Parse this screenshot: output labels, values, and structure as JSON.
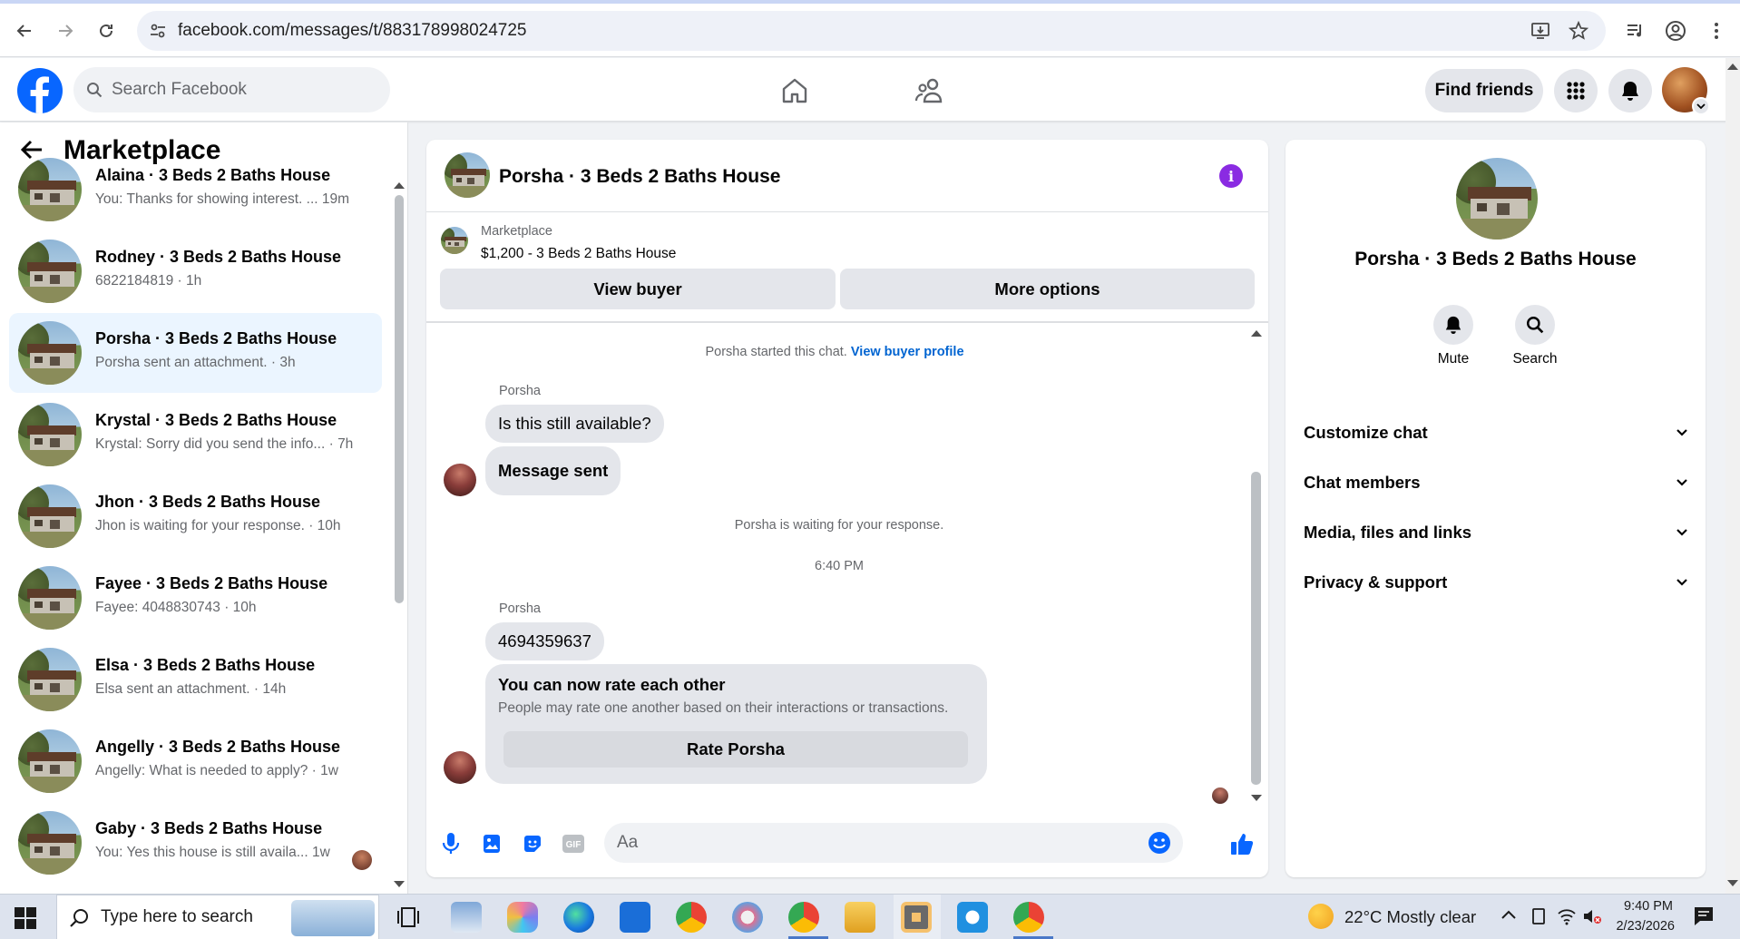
{
  "browser": {
    "url": "facebook.com/messages/t/883178998024725"
  },
  "header": {
    "search_placeholder": "Search Facebook",
    "find_friends": "Find friends"
  },
  "sidebar": {
    "title": "Marketplace",
    "conversations": [
      {
        "name": "Alaina · 3 Beds 2 Baths House",
        "preview": "You: Thanks for showing interest. ...  19m"
      },
      {
        "name": "Rodney · 3 Beds 2 Baths House",
        "preview": "6822184819 · 1h"
      },
      {
        "name": "Porsha · 3 Beds 2 Baths House",
        "preview": "Porsha sent an attachment. · 3h"
      },
      {
        "name": "Krystal · 3 Beds 2 Baths House",
        "preview": "Krystal: Sorry did you send the info... · 7h"
      },
      {
        "name": "Jhon · 3 Beds 2 Baths House",
        "preview": "Jhon is waiting for your response. · 10h"
      },
      {
        "name": "Fayee · 3 Beds 2 Baths House",
        "preview": "Fayee: 4048830743 · 10h"
      },
      {
        "name": "Elsa · 3 Beds 2 Baths House",
        "preview": "Elsa sent an attachment. · 14h"
      },
      {
        "name": "Angelly · 3 Beds 2 Baths House",
        "preview": "Angelly: What is needed to apply? · 1w"
      },
      {
        "name": "Gaby · 3 Beds 2 Baths House",
        "preview": "You: Yes this house is still availa...   1w"
      }
    ]
  },
  "chat": {
    "title": "Porsha · 3 Beds 2 Baths House",
    "listing_source": "Marketplace",
    "listing_price": "$1,200 - 3 Beds 2 Baths House",
    "view_buyer": "View buyer",
    "more_options": "More options",
    "started_text": "Porsha started this chat.",
    "view_buyer_profile": "View buyer profile",
    "sender_1": "Porsha",
    "msg_1": "Is this still available?",
    "msg_2": "Message sent",
    "waiting": "Porsha is waiting for your response.",
    "time": "6:40 PM",
    "sender_2": "Porsha",
    "msg_3": "4694359637",
    "rate_title": "You can now rate each other",
    "rate_sub": "People may rate one another based on their interactions or transactions.",
    "rate_btn": "Rate Porsha",
    "composer_placeholder": "Aa"
  },
  "right_panel": {
    "title": "Porsha · 3 Beds 2 Baths House",
    "mute": "Mute",
    "search": "Search",
    "sections": [
      "Customize chat",
      "Chat members",
      "Media, files and links",
      "Privacy & support"
    ]
  },
  "taskbar": {
    "search_placeholder": "Type here to search",
    "weather": "22°C  Mostly clear",
    "time": "9:40 PM",
    "date": "2/23/2026"
  },
  "colors": {
    "fb_blue": "#0866ff",
    "active_conv": "#ebf5ff",
    "info_purple": "#8a2be2",
    "link_blue": "#0064d1"
  }
}
